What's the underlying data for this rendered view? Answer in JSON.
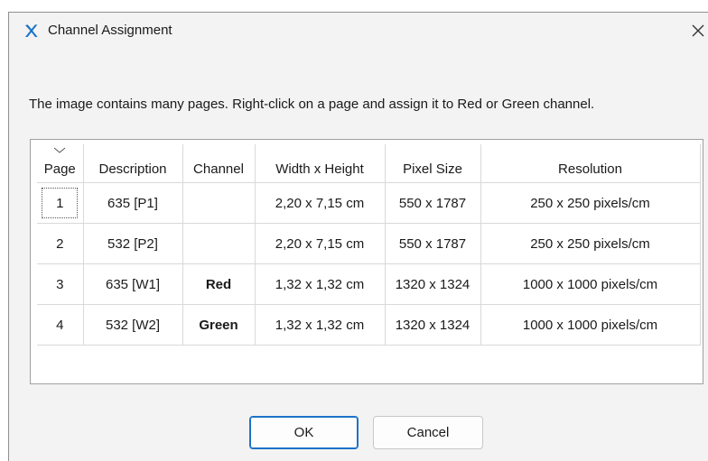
{
  "window": {
    "title": "Channel Assignment",
    "app_icon": "x-logo-icon",
    "close_icon": "close-icon",
    "accent_color": "#1a73c7"
  },
  "instruction": "The image contains many pages. Right-click on a page and assign it to Red or Green channel.",
  "table": {
    "columns": [
      "Page",
      "Description",
      "Channel",
      "Width x Height",
      "Pixel Size",
      "Resolution"
    ],
    "rows": [
      {
        "page": "1",
        "description": "635 [P1]",
        "channel": "",
        "size": "2,20 x 7,15 cm",
        "pixels": "550 x 1787",
        "resolution": "250 x 250 pixels/cm"
      },
      {
        "page": "2",
        "description": "532 [P2]",
        "channel": "",
        "size": "2,20 x 7,15 cm",
        "pixels": "550 x 1787",
        "resolution": "250 x 250 pixels/cm"
      },
      {
        "page": "3",
        "description": "635 [W1]",
        "channel": "Red",
        "size": "1,32 x 1,32 cm",
        "pixels": "1320 x 1324",
        "resolution": "1000 x 1000 pixels/cm"
      },
      {
        "page": "4",
        "description": "532 [W2]",
        "channel": "Green",
        "size": "1,32 x 1,32 cm",
        "pixels": "1320 x 1324",
        "resolution": "1000 x 1000 pixels/cm"
      }
    ]
  },
  "buttons": {
    "ok": "OK",
    "cancel": "Cancel"
  }
}
